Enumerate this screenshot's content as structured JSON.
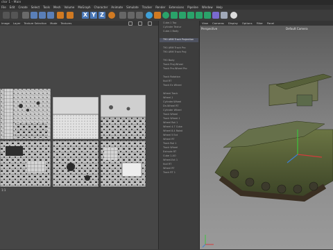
{
  "window": {
    "title": "ctor 1 - Main"
  },
  "menu": [
    "File",
    "Edit",
    "Create",
    "Select",
    "Tools",
    "Mesh",
    "Volume",
    "MoGraph",
    "Character",
    "Animate",
    "Simulate",
    "Tracker",
    "Render",
    "Extensions",
    "Pipeline",
    "Window",
    "Help"
  ],
  "toolbar": {
    "xyz": [
      "X",
      "Y",
      "Z"
    ]
  },
  "uv_panel": {
    "menu": [
      "Image",
      "Layer",
      "Texture Selection",
      "Mode",
      "Textures"
    ],
    "corner_label": "1:1"
  },
  "object_list": [
    "Cube.1 Top",
    "Cylinder Textur",
    "Cube.1 Body",
    "T90 ARM Track Projection",
    "T90 ARM Track Pro",
    "T90 ARM Track Proj",
    "T90 Body",
    "Track Proj.Wheel",
    "Track Pro.Wheel Pro",
    "Track Rotation",
    "Null RT",
    "Track Ex Wheel",
    "Wheel.Track",
    "Wheel.1",
    "Cylinder.Wheel",
    "Dn.Wheel RT",
    "Cylinder Wheel",
    "Track Wheel",
    "Track Wheel.1",
    "Wheel Rot 1",
    "Wheel 4.7 Cube",
    "Wheel 8.4 Rotat",
    "Wheel 5 Ext",
    "Wheel RT",
    "Track Rot 1",
    "Track Wheel",
    "Extrude RT",
    "Cube 1.AO",
    "Wheel.Ext 1",
    "Null RT",
    "Wheel RT",
    "Track RT 1"
  ],
  "viewport": {
    "menu": [
      "View",
      "Cameras",
      "Display",
      "Options",
      "Filter",
      "Panel"
    ],
    "mode": "Perspective",
    "camera": "Default Camera"
  },
  "colors": {
    "accent": "#4a78b8",
    "selection": "#4e5260",
    "tank_green": "#4f5a33",
    "axis_x": "#d23c3c",
    "axis_y": "#3cc43c",
    "axis_z": "#3c7fd2"
  }
}
